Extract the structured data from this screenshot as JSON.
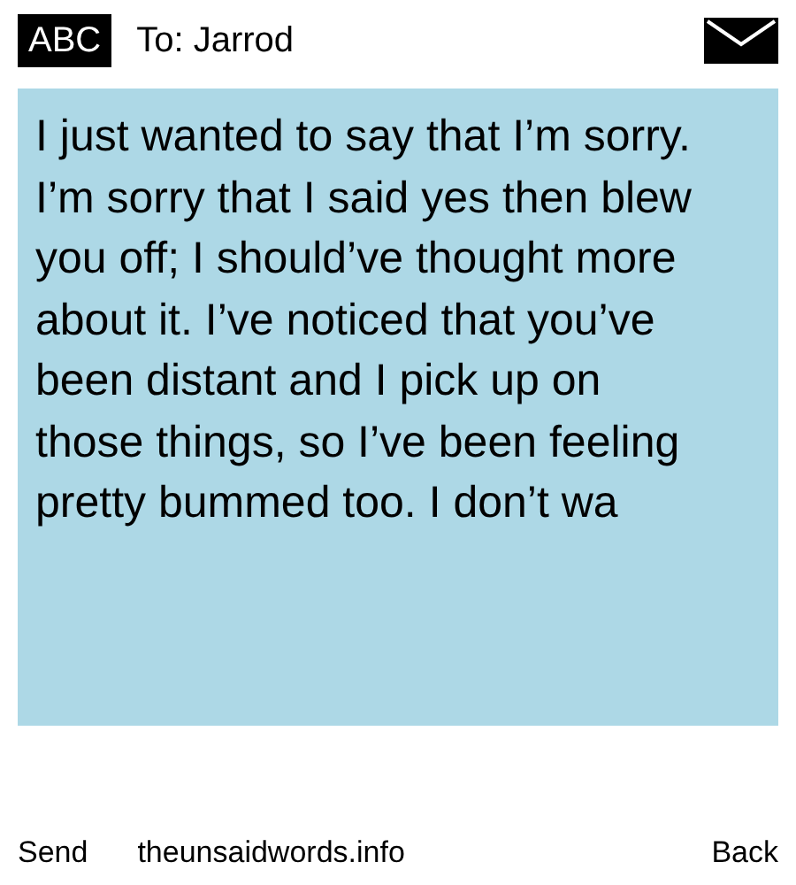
{
  "header": {
    "badge": "ABC",
    "recipient": "To: Jarrod"
  },
  "message": {
    "text": "I just wanted to say that I’m sorry. I’m sorry that I said yes then blew you off; I should’ve thought more about it. I’ve noticed that you’ve been distant and I pick up on those things, so I’ve been feeling pretty bummed too. I don’t wa"
  },
  "footer": {
    "left": "Send",
    "center": "theunsaidwords.info",
    "right": "Back"
  }
}
